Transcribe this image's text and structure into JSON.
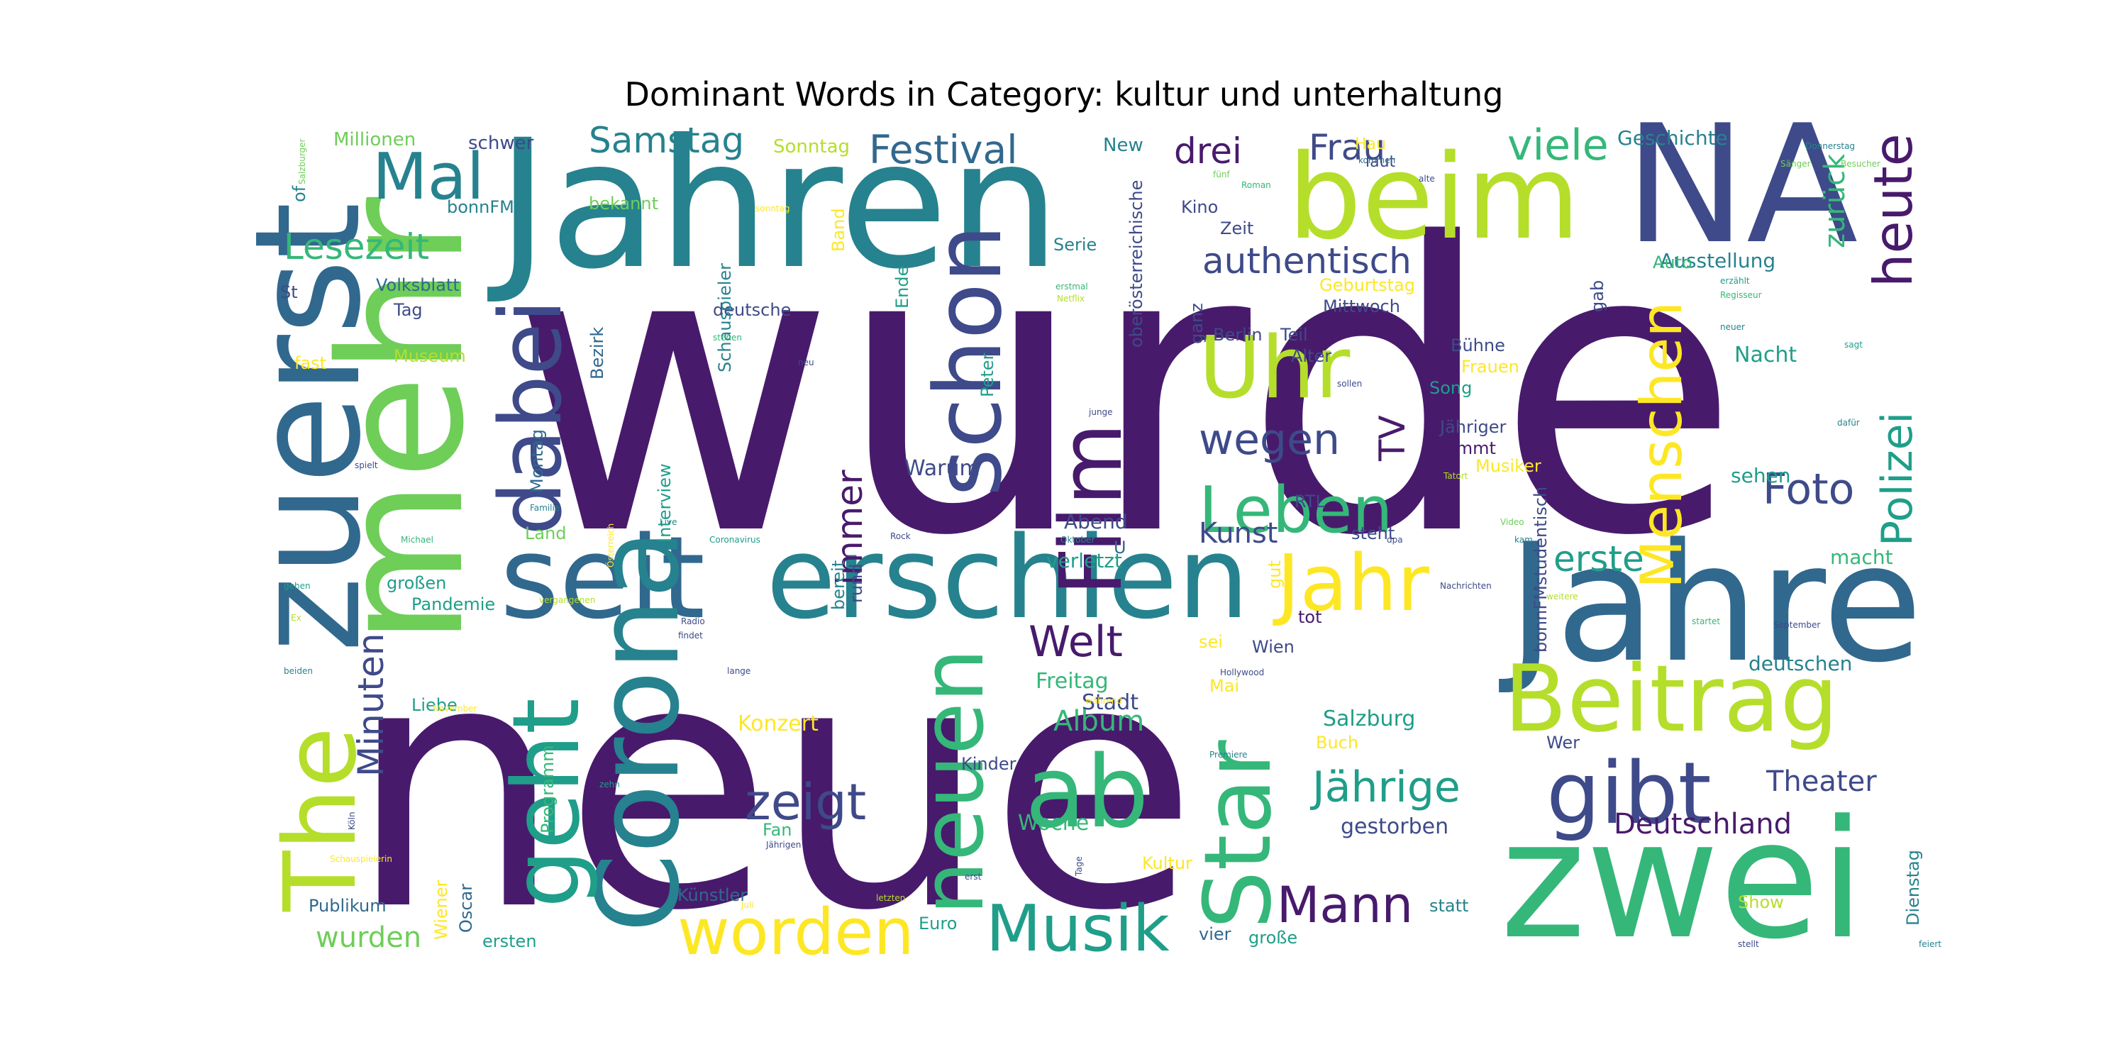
{
  "title": "Dominant Words in Category: kultur und unterhaltung",
  "palette": {
    "dark_purple": "#481a6c",
    "indigo": "#3e4a89",
    "blue": "#31688e",
    "teal": "#26828e",
    "green_teal": "#1f9e89",
    "green": "#35b779",
    "light_green": "#6ece58",
    "lime": "#b5de2b",
    "yellow": "#fde725"
  },
  "words": [
    {
      "text": "wurde",
      "color": "dark_purple"
    },
    {
      "text": "neue",
      "color": "dark_purple"
    },
    {
      "text": "Jahren",
      "color": "teal"
    },
    {
      "text": "mehr",
      "color": "light_green"
    },
    {
      "text": "NA",
      "color": "indigo"
    },
    {
      "text": "Jahre",
      "color": "blue"
    },
    {
      "text": "zwei",
      "color": "green"
    },
    {
      "text": "erschien",
      "color": "teal"
    },
    {
      "text": "seit",
      "color": "blue"
    },
    {
      "text": "beim",
      "color": "lime"
    },
    {
      "text": "Beitrag",
      "color": "lime"
    },
    {
      "text": "gibt",
      "color": "indigo"
    },
    {
      "text": "ab",
      "color": "green"
    },
    {
      "text": "zuerst",
      "color": "blue"
    },
    {
      "text": "The",
      "color": "lime"
    },
    {
      "text": "Corona",
      "color": "teal"
    },
    {
      "text": "schon",
      "color": "indigo"
    },
    {
      "text": "Film",
      "color": "dark_purple"
    },
    {
      "text": "Star",
      "color": "green"
    },
    {
      "text": "neuen",
      "color": "green"
    },
    {
      "text": "geht",
      "color": "green_teal"
    },
    {
      "text": "dabei",
      "color": "indigo"
    },
    {
      "text": "Uhr",
      "color": "lime"
    },
    {
      "text": "Jahr",
      "color": "yellow"
    },
    {
      "text": "Menschen",
      "color": "yellow"
    },
    {
      "text": "heute",
      "color": "dark_purple"
    },
    {
      "text": "Polizei",
      "color": "green_teal"
    },
    {
      "text": "Mal",
      "color": "teal"
    },
    {
      "text": "Leben",
      "color": "green"
    },
    {
      "text": "Musik",
      "color": "green_teal"
    },
    {
      "text": "worden",
      "color": "yellow"
    },
    {
      "text": "Mann",
      "color": "dark_purple"
    },
    {
      "text": "zeigt",
      "color": "indigo"
    },
    {
      "text": "Jährige",
      "color": "green_teal"
    },
    {
      "text": "Festival",
      "color": "blue"
    },
    {
      "text": "Foto",
      "color": "indigo"
    },
    {
      "text": "Welt",
      "color": "dark_purple"
    },
    {
      "text": "wegen",
      "color": "indigo"
    },
    {
      "text": "viele",
      "color": "green"
    },
    {
      "text": "drei",
      "color": "dark_purple"
    },
    {
      "text": "Frau",
      "color": "indigo"
    },
    {
      "text": "authentisch",
      "color": "indigo"
    },
    {
      "text": "Samstag",
      "color": "teal"
    },
    {
      "text": "Lesezeit",
      "color": "green"
    },
    {
      "text": "Minuten",
      "color": "indigo"
    },
    {
      "text": "immer",
      "color": "dark_purple"
    },
    {
      "text": "erste",
      "color": "green_teal"
    },
    {
      "text": "Deutschland",
      "color": "dark_purple"
    },
    {
      "text": "Theater",
      "color": "indigo"
    },
    {
      "text": "Album",
      "color": "green"
    },
    {
      "text": "Kunst",
      "color": "indigo"
    },
    {
      "text": "TV",
      "color": "dark_purple"
    },
    {
      "text": "zurück",
      "color": "green"
    },
    {
      "text": "Freitag",
      "color": "green"
    },
    {
      "text": "Stadt",
      "color": "indigo"
    },
    {
      "text": "Konzert",
      "color": "yellow"
    },
    {
      "text": "Warum",
      "color": "indigo"
    },
    {
      "text": "wurden",
      "color": "light_green"
    },
    {
      "text": "Woche",
      "color": "green"
    },
    {
      "text": "Salzburg",
      "color": "green_teal"
    },
    {
      "text": "gestorben",
      "color": "indigo"
    },
    {
      "text": "deutschen",
      "color": "teal"
    },
    {
      "text": "macht",
      "color": "green"
    },
    {
      "text": "verletzt",
      "color": "green_teal"
    },
    {
      "text": "Abend",
      "color": "indigo"
    },
    {
      "text": "sehen",
      "color": "green_teal"
    },
    {
      "text": "Nacht",
      "color": "green_teal"
    },
    {
      "text": "Geschichte",
      "color": "teal"
    },
    {
      "text": "Ausstellung",
      "color": "teal"
    },
    {
      "text": "Millionen",
      "color": "light_green"
    },
    {
      "text": "schwer",
      "color": "indigo"
    },
    {
      "text": "Sonntag",
      "color": "lime"
    },
    {
      "text": "New",
      "color": "teal"
    },
    {
      "text": "Hau",
      "color": "yellow"
    },
    {
      "text": "laut",
      "color": "indigo"
    },
    {
      "text": "bonnFM",
      "color": "teal"
    },
    {
      "text": "bekannt",
      "color": "light_green"
    },
    {
      "text": "Band",
      "color": "yellow"
    },
    {
      "text": "Serie",
      "color": "teal"
    },
    {
      "text": "oberösterreichische",
      "color": "indigo"
    },
    {
      "text": "Kino",
      "color": "indigo"
    },
    {
      "text": "Zeit",
      "color": "indigo"
    },
    {
      "text": "ganz",
      "color": "indigo"
    },
    {
      "text": "Auto",
      "color": "green"
    },
    {
      "text": "gab",
      "color": "indigo"
    },
    {
      "text": "Geburtstag",
      "color": "yellow"
    },
    {
      "text": "Mittwoch",
      "color": "indigo"
    },
    {
      "text": "Ende",
      "color": "green_teal"
    },
    {
      "text": "Bezirk",
      "color": "blue"
    },
    {
      "text": "Volksblatt",
      "color": "blue"
    },
    {
      "text": "deutsche",
      "color": "indigo"
    },
    {
      "text": "Tag",
      "color": "indigo"
    },
    {
      "text": "fast",
      "color": "yellow"
    },
    {
      "text": "Museum",
      "color": "lime"
    },
    {
      "text": "Peter",
      "color": "green_teal"
    },
    {
      "text": "Berlin",
      "color": "indigo"
    },
    {
      "text": "Teil",
      "color": "indigo"
    },
    {
      "text": "Alter",
      "color": "indigo"
    },
    {
      "text": "Bühne",
      "color": "indigo"
    },
    {
      "text": "Frauen",
      "color": "yellow"
    },
    {
      "text": "Song",
      "color": "green_teal"
    },
    {
      "text": "Jähriger",
      "color": "indigo"
    },
    {
      "text": "kommt",
      "color": "dark_purple"
    },
    {
      "text": "Musiker",
      "color": "yellow"
    },
    {
      "text": "RTL",
      "color": "indigo"
    },
    {
      "text": "Montag",
      "color": "blue"
    },
    {
      "text": "Interview",
      "color": "green_teal"
    },
    {
      "text": "Schauspieler",
      "color": "teal"
    },
    {
      "text": "St",
      "color": "indigo"
    },
    {
      "text": "of",
      "color": "teal"
    },
    {
      "text": "Land",
      "color": "light_green"
    },
    {
      "text": "großen",
      "color": "green_teal"
    },
    {
      "text": "Pandemie",
      "color": "green_teal"
    },
    {
      "text": "bereit",
      "color": "teal"
    },
    {
      "text": "rund",
      "color": "indigo"
    },
    {
      "text": "U",
      "color": "blue"
    },
    {
      "text": "sei",
      "color": "yellow"
    },
    {
      "text": "Wien",
      "color": "indigo"
    },
    {
      "text": "tot",
      "color": "dark_purple"
    },
    {
      "text": "bonnFMstudentisch",
      "color": "indigo"
    },
    {
      "text": "steht",
      "color": "indigo"
    },
    {
      "text": "gut",
      "color": "yellow"
    },
    {
      "text": "Mai",
      "color": "yellow"
    },
    {
      "text": "Buch",
      "color": "yellow"
    },
    {
      "text": "Wer",
      "color": "indigo"
    },
    {
      "text": "Kinder",
      "color": "indigo"
    },
    {
      "text": "Fan",
      "color": "green"
    },
    {
      "text": "Kultur",
      "color": "yellow"
    },
    {
      "text": "Liebe",
      "color": "green_teal"
    },
    {
      "text": "Programm",
      "color": "green"
    },
    {
      "text": "Publikum",
      "color": "blue"
    },
    {
      "text": "Wiener",
      "color": "yellow"
    },
    {
      "text": "Oscar",
      "color": "blue"
    },
    {
      "text": "ersten",
      "color": "green_teal"
    },
    {
      "text": "Künstler",
      "color": "blue"
    },
    {
      "text": "Euro",
      "color": "green_teal"
    },
    {
      "text": "vier",
      "color": "blue"
    },
    {
      "text": "große",
      "color": "green_teal"
    },
    {
      "text": "statt",
      "color": "teal"
    },
    {
      "text": "Show",
      "color": "lime"
    },
    {
      "text": "Dienstag",
      "color": "teal"
    },
    {
      "text": "Donnerstag",
      "color": "teal"
    },
    {
      "text": "Besucher",
      "color": "light_green"
    },
    {
      "text": "Sänger",
      "color": "light_green"
    },
    {
      "text": "Salzburger",
      "color": "light_green"
    },
    {
      "text": "sonntag",
      "color": "yellow"
    },
    {
      "text": "fünf",
      "color": "light_green"
    },
    {
      "text": "Roman",
      "color": "green"
    },
    {
      "text": "kommen",
      "color": "blue"
    },
    {
      "text": "alte",
      "color": "indigo"
    },
    {
      "text": "erzählt",
      "color": "green_teal"
    },
    {
      "text": "Regisseur",
      "color": "green"
    },
    {
      "text": "erstmal",
      "color": "green"
    },
    {
      "text": "Netflix",
      "color": "lime"
    },
    {
      "text": "stehen",
      "color": "green"
    },
    {
      "text": "neu",
      "color": "indigo"
    },
    {
      "text": "neuer",
      "color": "teal"
    },
    {
      "text": "sagt",
      "color": "green_teal"
    },
    {
      "text": "junge",
      "color": "indigo"
    },
    {
      "text": "sollen",
      "color": "indigo"
    },
    {
      "text": "dafür",
      "color": "teal"
    },
    {
      "text": "spielt",
      "color": "indigo"
    },
    {
      "text": "Tatort",
      "color": "lime"
    },
    {
      "text": "Familie",
      "color": "teal"
    },
    {
      "text": "Live",
      "color": "teal"
    },
    {
      "text": "Rock",
      "color": "indigo"
    },
    {
      "text": "Video",
      "color": "light_green"
    },
    {
      "text": "Michael",
      "color": "green"
    },
    {
      "text": "Coronavirus",
      "color": "green_teal"
    },
    {
      "text": "Österreich",
      "color": "yellow"
    },
    {
      "text": "Oktober",
      "color": "teal"
    },
    {
      "text": "dpa",
      "color": "indigo"
    },
    {
      "text": "kam",
      "color": "teal"
    },
    {
      "text": "Nachrichten",
      "color": "indigo"
    },
    {
      "text": "gehen",
      "color": "green_teal"
    },
    {
      "text": "Ex",
      "color": "lime"
    },
    {
      "text": "vergangenen",
      "color": "lime"
    },
    {
      "text": "Radio",
      "color": "indigo"
    },
    {
      "text": "findet",
      "color": "indigo"
    },
    {
      "text": "weitere",
      "color": "lime"
    },
    {
      "text": "startet",
      "color": "green"
    },
    {
      "text": "September",
      "color": "indigo"
    },
    {
      "text": "beiden",
      "color": "teal"
    },
    {
      "text": "lange",
      "color": "indigo"
    },
    {
      "text": "während",
      "color": "yellow"
    },
    {
      "text": "Hollywood",
      "color": "indigo"
    },
    {
      "text": "Premiere",
      "color": "teal"
    },
    {
      "text": "November",
      "color": "yellow"
    },
    {
      "text": "zehn",
      "color": "green_teal"
    },
    {
      "text": "Köln",
      "color": "indigo"
    },
    {
      "text": "Jährigen",
      "color": "indigo"
    },
    {
      "text": "Schauspielerin",
      "color": "yellow"
    },
    {
      "text": "erst",
      "color": "indigo"
    },
    {
      "text": "Tage",
      "color": "indigo"
    },
    {
      "text": "Juli",
      "color": "yellow"
    },
    {
      "text": "letzten",
      "color": "lime"
    },
    {
      "text": "stellt",
      "color": "indigo"
    },
    {
      "text": "feiert",
      "color": "teal"
    },
    {
      "text": "Wochenende",
      "color": "teal"
    }
  ]
}
